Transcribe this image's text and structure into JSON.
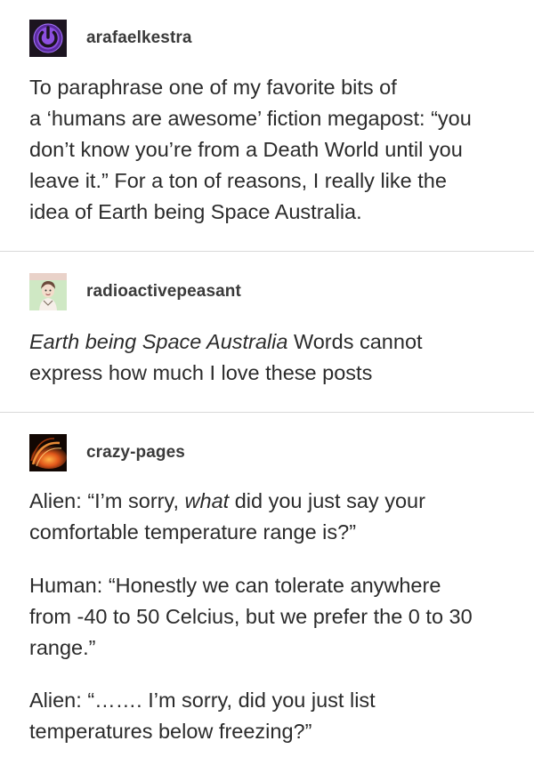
{
  "posts": [
    {
      "username": "arafaelkestra",
      "avatar_icon": "power-symbol-avatar",
      "lines": [
        "To paraphrase one of my favorite bits of",
        "a ‘humans are awesome’ fiction megapost: “you",
        "don’t know you’re from a Death World until you",
        "leave it.” For a ton of reasons, I really like the",
        "idea of Earth being Space Australia."
      ]
    },
    {
      "username": "radioactivepeasant",
      "avatar_icon": "cartoon-character-avatar",
      "italic_text": "Earth being Space Australia",
      "line1_rest": " Words cannot",
      "line2": "express how much I love these posts"
    },
    {
      "username": "crazy-pages",
      "avatar_icon": "fire-arc-avatar",
      "p1_l1_a": "Alien: “I’m sorry, ",
      "p1_l1_em": "what",
      "p1_l1_b": " did you just say your",
      "p1_l2": "comfortable temperature range is?”",
      "p2_lines": [
        "Human: “Honestly we can tolerate anywhere",
        "from -40 to 50 Celcius, but we prefer the 0 to 30",
        "range.”"
      ],
      "p3_lines": [
        "Alien: “……. I’m sorry, did you just list",
        "temperatures below freezing?”"
      ]
    }
  ],
  "colors": {
    "text": "#2b2b2b",
    "divider": "#d9d9d9",
    "avatar1_bg": "#1c1420",
    "avatar1_accent": "#7b3fc6"
  }
}
